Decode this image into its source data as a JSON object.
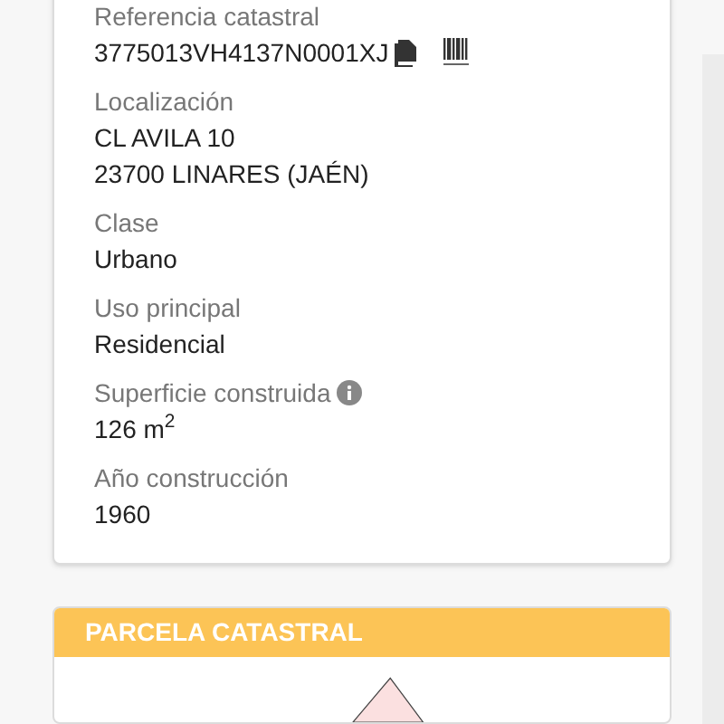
{
  "fields": [
    {
      "label": "Referencia catastral",
      "values": [
        "3775013VH4137N0001XJ"
      ],
      "kind": "reference"
    },
    {
      "label": "Localización",
      "values": [
        "CL AVILA 10",
        "23700 LINARES (JAÉN)"
      ],
      "kind": "plain"
    },
    {
      "label": "Clase",
      "values": [
        "Urbano"
      ],
      "kind": "plain"
    },
    {
      "label": "Uso principal",
      "values": [
        "Residencial"
      ],
      "kind": "plain"
    },
    {
      "label": "Superficie construida",
      "values": [
        "126 m$^{2}$"
      ],
      "kind": "info"
    },
    {
      "label": "Año construcción",
      "values": [
        "1960"
      ],
      "kind": "plain"
    }
  ],
  "parcel_card": {
    "title": "PARCELA CATASTRAL"
  }
}
